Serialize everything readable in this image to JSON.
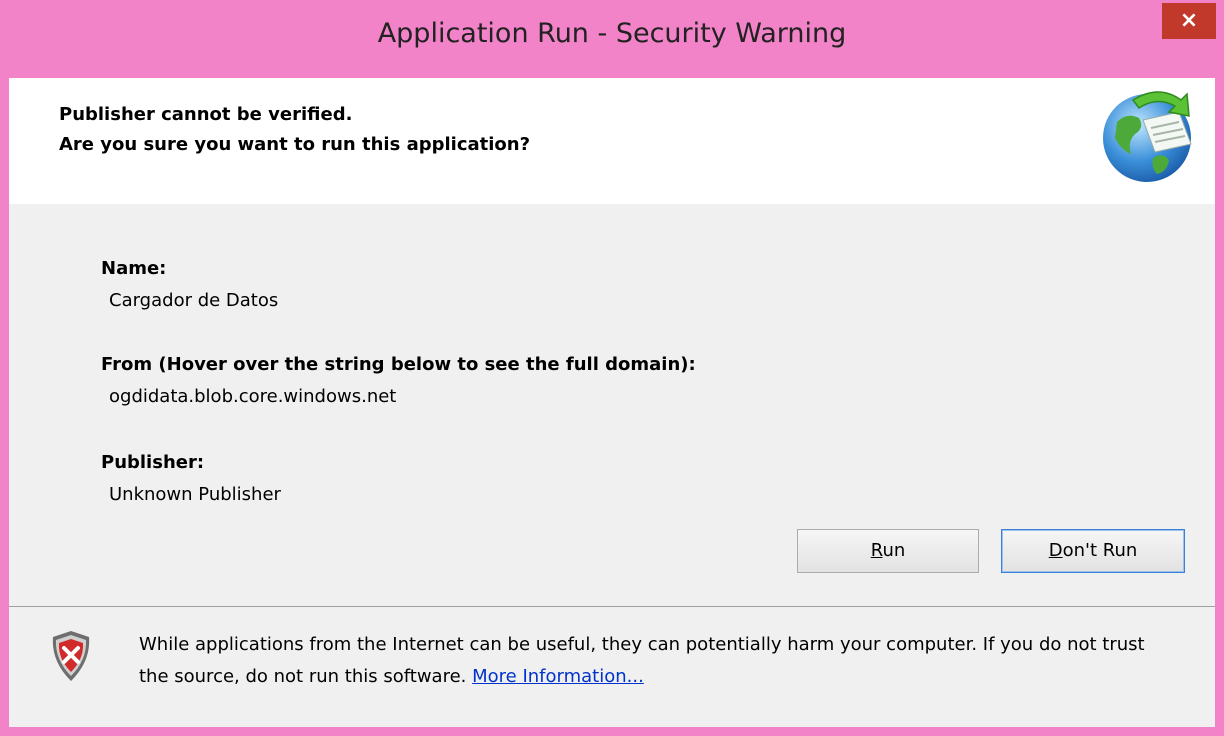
{
  "window": {
    "title": "Application Run - Security Warning",
    "close_glyph": "×"
  },
  "header": {
    "line1": "Publisher cannot be verified.",
    "line2": "Are you sure you want to run this application?",
    "icon": "globe-document-icon"
  },
  "details": {
    "name_label": "Name:",
    "name_value": "Cargador de Datos",
    "from_label": "From (Hover over the string below to see the full domain):",
    "from_value": "ogdidata.blob.core.windows.net",
    "publisher_label": "Publisher:",
    "publisher_value": "Unknown Publisher"
  },
  "buttons": {
    "run_accel": "R",
    "run_rest": "un",
    "dontrun_accel": "D",
    "dontrun_rest": "on't Run"
  },
  "footer": {
    "warning_text": "While applications from the Internet can be useful, they can potentially harm your computer. If you do not trust the source, do not run this software.",
    "link_text": "More Information...",
    "icon": "shield-error-icon"
  },
  "colors": {
    "frame": "#F283C8",
    "close": "#C0392B",
    "link": "#0033CC"
  }
}
